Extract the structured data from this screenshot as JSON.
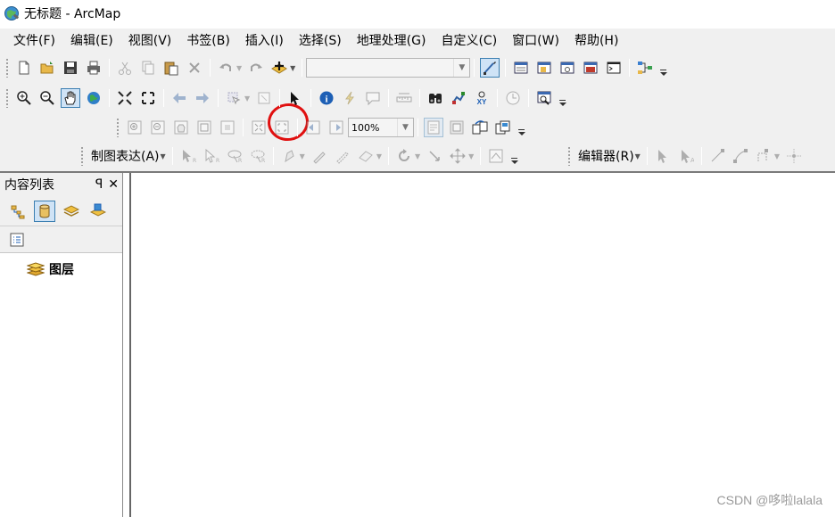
{
  "window": {
    "title": "无标题 - ArcMap",
    "icon": "arcmap-globe-icon"
  },
  "menu": [
    {
      "label": "文件(F)"
    },
    {
      "label": "编辑(E)"
    },
    {
      "label": "视图(V)"
    },
    {
      "label": "书签(B)"
    },
    {
      "label": "插入(I)"
    },
    {
      "label": "选择(S)"
    },
    {
      "label": "地理处理(G)"
    },
    {
      "label": "自定义(C)"
    },
    {
      "label": "窗口(W)"
    },
    {
      "label": "帮助(H)"
    }
  ],
  "toolbars": {
    "standard": {
      "icons": [
        "new-document-icon",
        "open-folder-icon",
        "save-icon",
        "print-icon",
        "cut-icon",
        "copy-icon",
        "paste-icon",
        "delete-icon",
        "undo-icon",
        "redo-icon",
        "add-data-icon",
        "scale-combo",
        "editor-toolbar-icon",
        "table-of-contents-icon",
        "catalog-icon",
        "search-icon",
        "arctoolbox-icon",
        "python-icon",
        "modelbuilder-icon"
      ],
      "scale_value": "",
      "highlighted": "add-data-icon",
      "annotation_color": "#e01010"
    },
    "tools": {
      "icons": [
        "zoom-in-icon",
        "zoom-out-icon",
        "pan-icon",
        "full-extent-icon",
        "fixed-zoom-in-icon",
        "fixed-zoom-out-icon",
        "go-back-icon",
        "go-forward-icon",
        "select-features-icon",
        "clear-selection-icon",
        "select-elements-icon",
        "identify-icon",
        "hyperlink-icon",
        "html-popup-icon",
        "measure-icon",
        "find-icon",
        "find-route-icon",
        "go-to-xy-icon",
        "time-slider-icon",
        "magnifier-icon"
      ]
    },
    "layout": {
      "icons": [
        "layout-zoom-in-icon",
        "layout-zoom-out-icon",
        "layout-pan-icon",
        "zoom-whole-page-icon",
        "zoom-100-icon",
        "fixed-zoom-in-icon",
        "fixed-zoom-out-icon",
        "previous-extent-icon",
        "next-extent-icon",
        "toggle-draft-mode-icon",
        "focus-data-frame-icon",
        "change-layout-icon",
        "data-driven-pages-icon"
      ],
      "zoom_value": "100%"
    },
    "representation": {
      "label": "制图表达(A)",
      "icons": [
        "select-representation-icon",
        "direct-select-icon",
        "lasso-select-icon",
        "lasso-direct-select-icon",
        "free-representation-icon",
        "representation-properties-icon",
        "eraser-icon",
        "rotate-icon",
        "move-icon",
        "pan-marker-icon",
        "representation-panel-icon"
      ]
    },
    "editor": {
      "label": "编辑器(R)",
      "icons": [
        "edit-tool-icon",
        "edit-annotation-icon",
        "straight-segment-icon",
        "endpoint-arc-icon",
        "trace-icon",
        "point-icon"
      ]
    }
  },
  "toc": {
    "title": "内容列表",
    "pin_glyph": "ꟼ",
    "close_glyph": "✕",
    "tools": [
      "list-by-drawing-order-icon",
      "list-by-source-icon",
      "list-by-visibility-icon",
      "list-by-selection-icon"
    ],
    "options_icon": "options-icon",
    "layers_label": "图层"
  },
  "watermark": "CSDN @哆啦lalala"
}
